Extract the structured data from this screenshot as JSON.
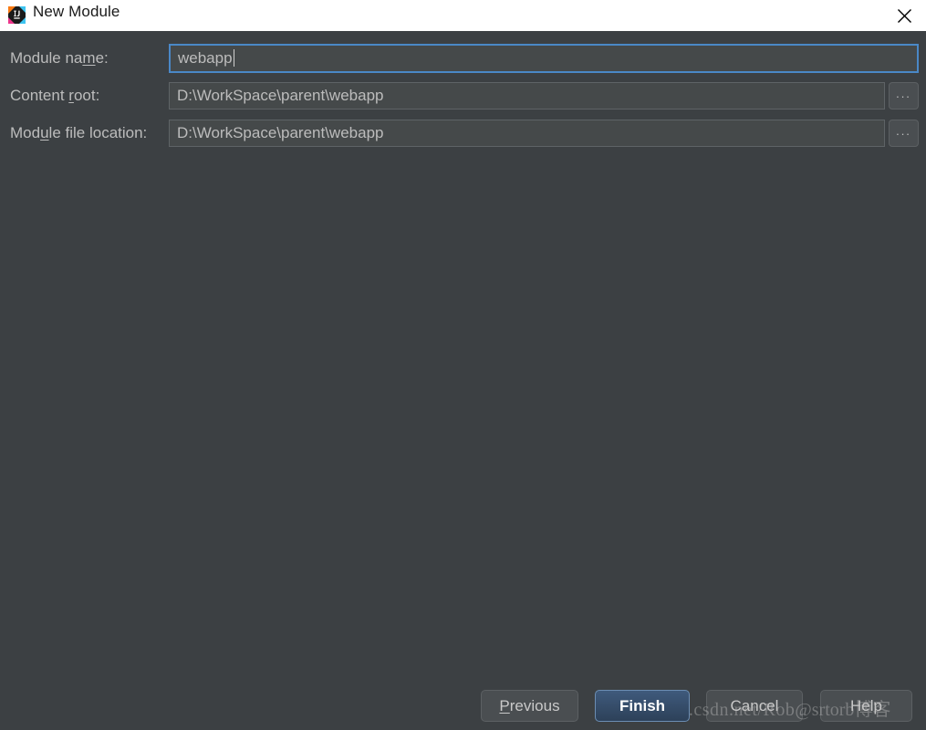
{
  "window": {
    "title": "New Module",
    "app_icon": "intellij-idea-logo-icon",
    "close_icon": "close-icon"
  },
  "form": {
    "fields": [
      {
        "label_before": "Module na",
        "label_mnemonic": "m",
        "label_after": "e:",
        "value": "webapp",
        "focused": true,
        "has_browse": false,
        "browse_label": "..."
      },
      {
        "label_before": "Content ",
        "label_mnemonic": "r",
        "label_after": "oot:",
        "value": "D:\\WorkSpace\\parent\\webapp",
        "focused": false,
        "has_browse": true,
        "browse_label": "..."
      },
      {
        "label_before": "Mod",
        "label_mnemonic": "u",
        "label_after": "le file location:",
        "value": "D:\\WorkSpace\\parent\\webapp",
        "focused": false,
        "has_browse": true,
        "browse_label": "..."
      }
    ]
  },
  "buttons": {
    "previous": {
      "before": "",
      "mnemonic": "P",
      "after": "revious"
    },
    "finish": {
      "before": "",
      "mnemonic": "F",
      "after": "inish"
    },
    "cancel": {
      "before": "Cancel",
      "mnemonic": "",
      "after": ""
    },
    "help": {
      "before": "Help",
      "mnemonic": "",
      "after": ""
    }
  },
  "watermark": {
    "text": "http://blog.csdn.net/Rob",
    "suffix": "@srtorb博客"
  },
  "colors": {
    "panel_background": "#3c4043",
    "titlebar_background": "#ffffff",
    "field_background": "#45494a",
    "field_border": "#5e6366",
    "field_focus_border": "#4a88c7",
    "label_text": "#bcbcbc",
    "button_background": "#4a4e51",
    "default_button_background": "#2d4159",
    "default_button_border": "#6b8db3"
  }
}
